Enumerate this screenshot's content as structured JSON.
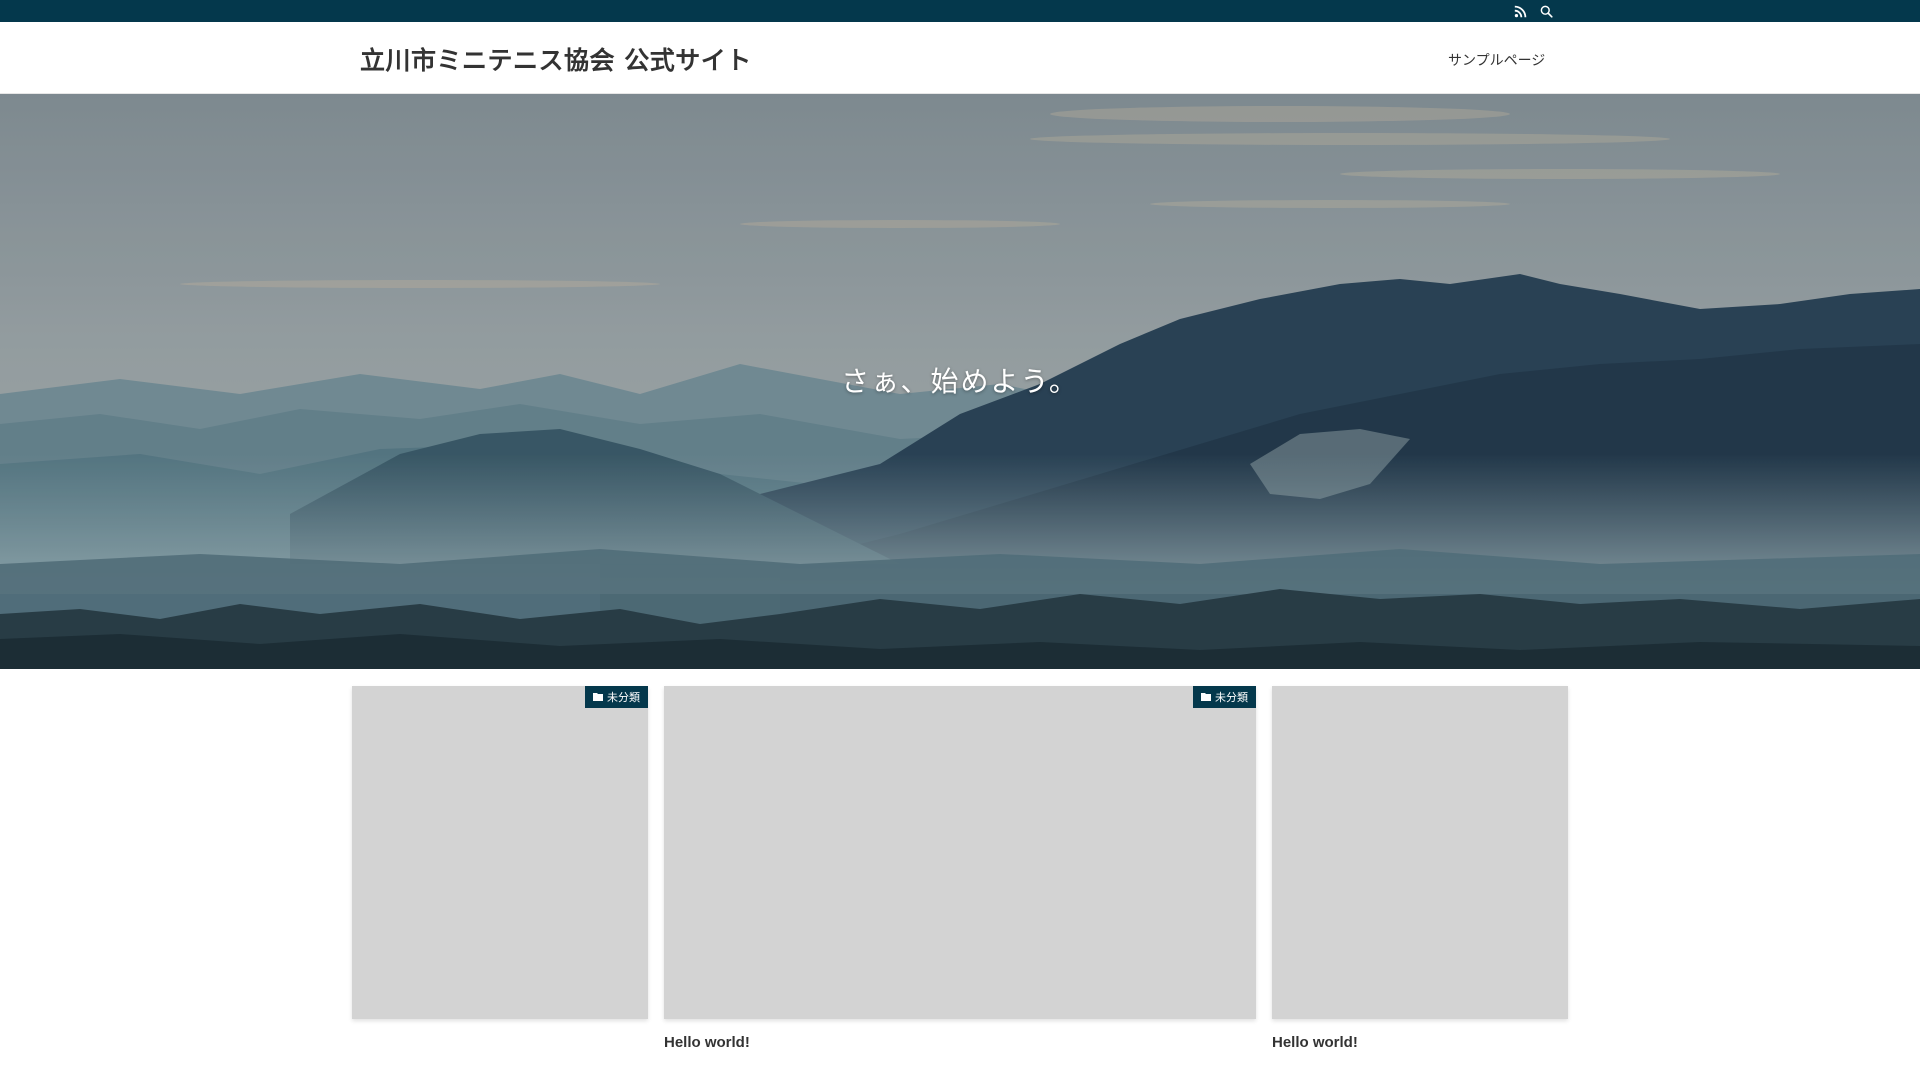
{
  "topbar": {
    "icons": [
      "rss-icon",
      "search-icon"
    ],
    "color": "#04384c"
  },
  "header": {
    "site_title": "立川市ミニテニス協会 公式サイト",
    "nav": [
      {
        "label": "サンプルページ"
      }
    ]
  },
  "hero": {
    "catchphrase": "さぁ、始めよう。"
  },
  "cards": [
    {
      "category": "未分類",
      "category_icon": "folder-icon",
      "title": ""
    },
    {
      "category": "未分類",
      "category_icon": "folder-icon",
      "title": "Hello world!"
    },
    {
      "category": "",
      "title": "Hello world!"
    }
  ],
  "colors": {
    "accent": "#04384c",
    "thumb_placeholder": "#d3d3d3"
  }
}
